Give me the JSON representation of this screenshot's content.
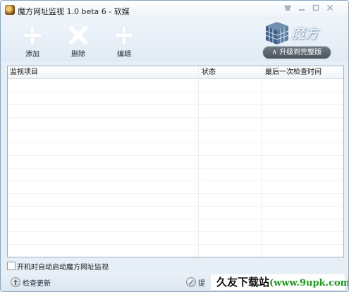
{
  "window": {
    "title": "魔方网址监视 1.0 beta 6 - 软媒",
    "controls": [
      "shirt-icon",
      "minimize-icon",
      "maximize-icon",
      "close-icon"
    ]
  },
  "toolbar": {
    "add_label": "添加",
    "delete_label": "删除",
    "edit_label": "编辑",
    "icon_color": "#ffffff"
  },
  "brand": {
    "logo_text": "魔方",
    "upgrade_label": "升级到完整版"
  },
  "table": {
    "columns": [
      "监视项目",
      "状态",
      "最后一次检查时间"
    ],
    "rows": []
  },
  "options": {
    "autostart_label": "开机时自动启动魔方网址监视",
    "autostart_checked": false
  },
  "statusbar": {
    "check_update_label": "检查更新",
    "feedback_label": "提",
    "watermark_text": "久友下载站",
    "watermark_url": "(www.9upk.com)"
  },
  "colors": {
    "window_bg": "#e6eef6",
    "border": "#8aa6c1",
    "upgrade_bg": "#55606a"
  }
}
